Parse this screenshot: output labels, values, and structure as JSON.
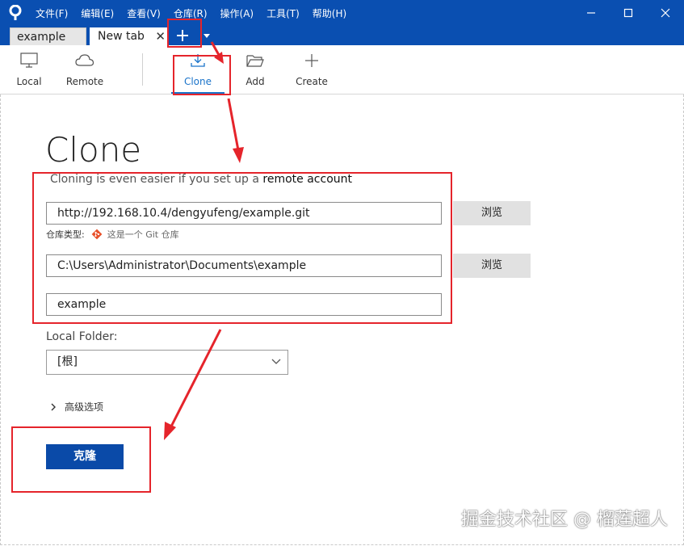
{
  "menu": {
    "items": [
      "文件(F)",
      "编辑(E)",
      "查看(V)",
      "仓库(R)",
      "操作(A)",
      "工具(T)",
      "帮助(H)"
    ]
  },
  "tabs": {
    "items": [
      {
        "label": "example"
      },
      {
        "label": "New tab"
      }
    ],
    "add_symbol": "+"
  },
  "toolbar": {
    "local": "Local",
    "remote": "Remote",
    "clone": "Clone",
    "add": "Add",
    "create": "Create",
    "active": "clone"
  },
  "clone_page": {
    "title": "Clone",
    "hint_prefix": "Cloning is even easier if you set up a",
    "hint_link": "remote account",
    "source_url": "http://192.168.10.4/dengyufeng/example.git",
    "browse_label": "浏览",
    "repo_type_label": "仓库类型:",
    "repo_type_value": "这是一个 Git 仓库",
    "destination_path": "C:\\Users\\Administrator\\Documents\\example",
    "name": "example",
    "local_folder_label": "Local Folder:",
    "local_folder_value": "[根]",
    "advanced_label": "高级选项",
    "clone_button": "克隆"
  },
  "watermark": "掘金技术社区 @ 榴莲超人",
  "colors": {
    "titlebar": "#0a4fb1",
    "accent": "#1a73c9",
    "primary_button": "#0a4aa8",
    "annotation": "#e5242b",
    "git": "#e8512b"
  }
}
